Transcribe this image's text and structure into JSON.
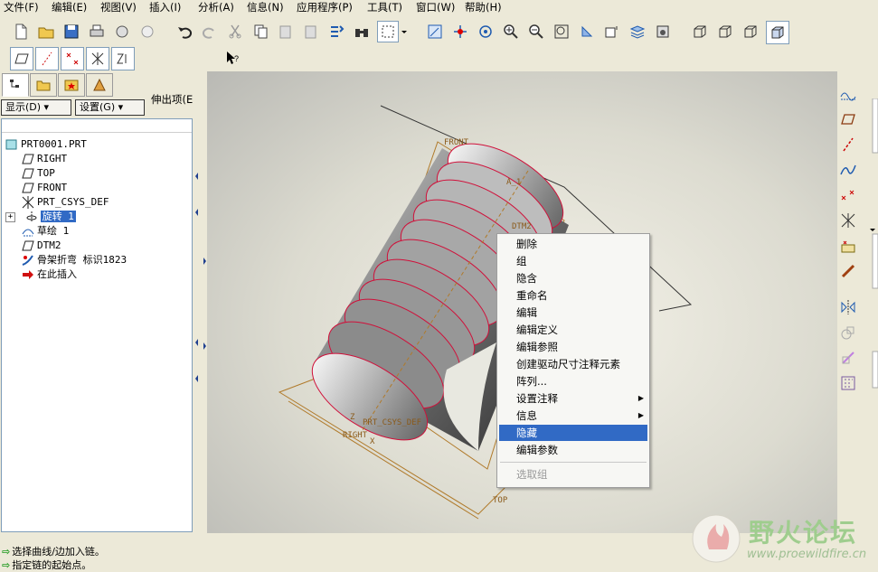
{
  "menubar": [
    {
      "label": "文件(F)",
      "name": "menu-file"
    },
    {
      "label": "编辑(E)",
      "name": "menu-edit"
    },
    {
      "label": "视图(V)",
      "name": "menu-view"
    },
    {
      "label": "插入(I)",
      "name": "menu-insert"
    },
    {
      "label": "分析(A)",
      "name": "menu-analysis"
    },
    {
      "label": "信息(N)",
      "name": "menu-info"
    },
    {
      "label": "应用程序(P)",
      "name": "menu-applications"
    },
    {
      "label": "工具(T)",
      "name": "menu-tools"
    },
    {
      "label": "窗口(W)",
      "name": "menu-window"
    },
    {
      "label": "帮助(H)",
      "name": "menu-help"
    }
  ],
  "toolbar2": {
    "stretch_label": "伸出项(E)..."
  },
  "panel": {
    "show_button": "显示(D) ▾",
    "settings_button": "设置(G) ▾"
  },
  "tree": {
    "items": [
      {
        "label": "PRT0001.PRT",
        "icon": "part-icon"
      },
      {
        "label": "RIGHT",
        "icon": "datum-plane-icon"
      },
      {
        "label": "TOP",
        "icon": "datum-plane-icon"
      },
      {
        "label": "FRONT",
        "icon": "datum-plane-icon"
      },
      {
        "label": "PRT_CSYS_DEF",
        "icon": "csys-icon"
      },
      {
        "label": "旋转 1",
        "icon": "revolve-icon"
      },
      {
        "label": "草绘 1",
        "icon": "sketch-icon"
      },
      {
        "label": "DTM2",
        "icon": "datum-plane-icon"
      },
      {
        "label": "骨架折弯 标识1823",
        "icon": "spinal-bend-icon"
      },
      {
        "label": "在此插入",
        "icon": "insert-here-icon"
      }
    ]
  },
  "model_labels": {
    "front": "FRONT",
    "dtm2": "DTM2",
    "prt_csys": "PRT_CSYS_DEF",
    "right": "RIGHT",
    "top": "TOP",
    "a1": "A_1",
    "x": "X",
    "z": "Z"
  },
  "context_menu": {
    "items": [
      {
        "label": "删除",
        "name": "ctx-delete"
      },
      {
        "label": "组",
        "name": "ctx-group"
      },
      {
        "label": "隐含",
        "name": "ctx-suppress"
      },
      {
        "label": "重命名",
        "name": "ctx-rename"
      },
      {
        "label": "编辑",
        "name": "ctx-edit"
      },
      {
        "label": "编辑定义",
        "name": "ctx-edit-definition"
      },
      {
        "label": "编辑参照",
        "name": "ctx-edit-references"
      },
      {
        "label": "创建驱动尺寸注释元素",
        "name": "ctx-create-driving-dim"
      },
      {
        "label": "阵列...",
        "name": "ctx-pattern"
      },
      {
        "label": "设置注释",
        "name": "ctx-set-annotation"
      },
      {
        "label": "信息",
        "name": "ctx-info"
      },
      {
        "label": "隐藏",
        "name": "ctx-hide"
      },
      {
        "label": "编辑参数",
        "name": "ctx-edit-parameters"
      },
      {
        "label": "选取组",
        "name": "ctx-select-group"
      }
    ],
    "highlighted": "隐藏"
  },
  "status": {
    "line1": "选择曲线/边加入链。",
    "line2": "指定链的起始点。"
  },
  "watermark": {
    "title": "野火论坛",
    "url": "www.proewildfire.cn"
  },
  "colors": {
    "selection": "#316ac5",
    "model_edge": "#d0103a",
    "datum": "#b07a2a"
  }
}
